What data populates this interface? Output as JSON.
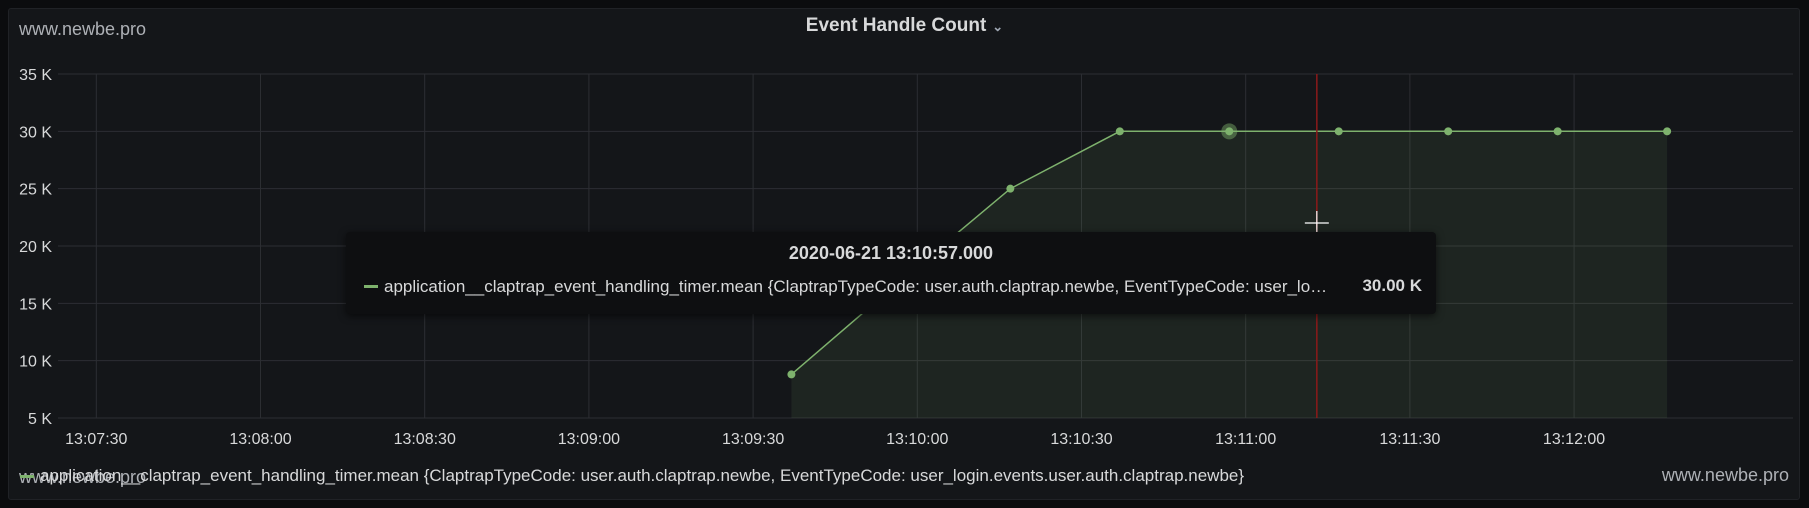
{
  "watermarks": {
    "top_left": "www.newbe.pro",
    "bottom_right": "www.newbe.pro",
    "bottom_left": "www.newbe.pro"
  },
  "panel": {
    "title": "Event Handle Count",
    "dropdown_icon": "chevron-down-icon"
  },
  "colors": {
    "series": "#7eb26d",
    "cursor": "#8b1a1a",
    "grid": "#2c2e33",
    "text": "#d8d9da"
  },
  "chart_data": {
    "type": "area",
    "title": "Event Handle Count",
    "y_ticks": [
      "5 K",
      "10 K",
      "15 K",
      "20 K",
      "25 K",
      "30 K",
      "35 K"
    ],
    "y_tick_values": [
      5000,
      10000,
      15000,
      20000,
      25000,
      30000,
      35000
    ],
    "ylim": [
      5000,
      35000
    ],
    "x_ticks": [
      "13:07:30",
      "13:08:00",
      "13:08:30",
      "13:09:00",
      "13:09:30",
      "13:10:00",
      "13:10:30",
      "13:11:00",
      "13:11:30",
      "13:12:00"
    ],
    "xlim": [
      "13:07:23",
      "13:12:40"
    ],
    "grid": true,
    "legend_position": "bottom-left",
    "series": [
      {
        "name": "application__claptrap_event_handling_timer.mean {ClaptrapTypeCode: user.auth.claptrap.newbe, EventTypeCode: user_login.events.user.auth.claptrap.newbe}",
        "x": [
          "13:09:37",
          "13:09:57",
          "13:10:17",
          "13:10:37",
          "13:10:57",
          "13:11:17",
          "13:11:37",
          "13:11:57",
          "13:12:17"
        ],
        "values": [
          8800,
          17000,
          25000,
          30000,
          30000,
          30000,
          30000,
          30000,
          30000
        ]
      }
    ],
    "cursor_time": "13:11:13",
    "hover_time": "13:10:57",
    "tooltip": {
      "time": "2020-06-21 13:10:57.000",
      "series_label": "application__claptrap_event_handling_timer.mean {ClaptrapTypeCode: user.auth.claptrap.newbe, EventTypeCode: user_login.events.user.auth.claptrap.newbe}",
      "value": "30.00 K"
    }
  }
}
